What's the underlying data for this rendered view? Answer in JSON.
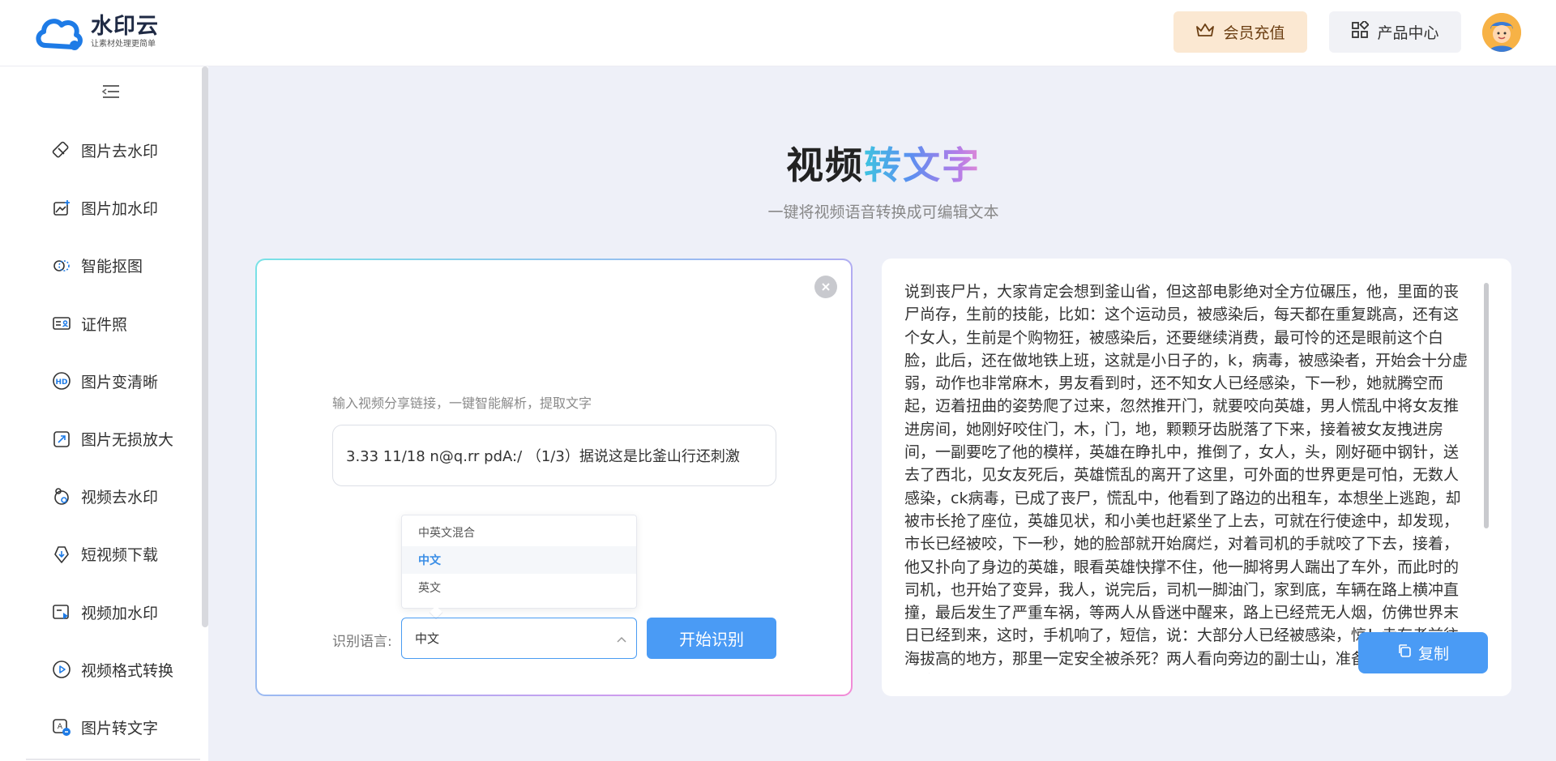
{
  "app": {
    "name": "水印云",
    "slogan": "让素材处理更简单"
  },
  "header": {
    "vip_label": "会员充值",
    "products_label": "产品中心"
  },
  "sidebar": {
    "items": [
      {
        "label": "图片去水印",
        "icon": "eraser-icon"
      },
      {
        "label": "图片加水印",
        "icon": "image-add-icon"
      },
      {
        "label": "智能抠图",
        "icon": "cutout-icon"
      },
      {
        "label": "证件照",
        "icon": "id-card-icon"
      },
      {
        "label": "图片变清晰",
        "icon": "hd-icon"
      },
      {
        "label": "图片无损放大",
        "icon": "expand-icon"
      },
      {
        "label": "视频去水印",
        "icon": "video-eraser-icon"
      },
      {
        "label": "短视频下载",
        "icon": "download-icon"
      },
      {
        "label": "视频加水印",
        "icon": "video-add-icon"
      },
      {
        "label": "视频格式转换",
        "icon": "play-circle-icon"
      },
      {
        "label": "图片转文字",
        "icon": "image-text-icon"
      }
    ]
  },
  "hero": {
    "title_part1": "视频",
    "title_part2": "转文字",
    "subtitle": "一键将视频语音转换成可编辑文本"
  },
  "input_panel": {
    "hint": "输入视频分享链接，一键智能解析，提取文字",
    "link_value": "3.33 11/18 n@q.rr pdA:/ （1/3）据说这是比釜山行还刺激",
    "language_label": "识别语言:",
    "language_selected": "中文",
    "language_options": [
      "中英文混合",
      "中文",
      "英文"
    ],
    "start_label": "开始识别"
  },
  "result_panel": {
    "text": "说到丧尸片，大家肯定会想到釜山省，但这部电影绝对全方位碾压，他，里面的丧尸尚存，生前的技能，比如：这个运动员，被感染后，每天都在重复跳高，还有这个女人，生前是个购物狂，被感染后，还要继续消费，最可怜的还是眼前这个白脸，此后，还在做地铁上班，这就是小日子的，k，病毒，被感染者，开始会十分虚弱，动作也非常麻木，男友看到时，还不知女人已经感染，下一秒，她就腾空而起，迈着扭曲的姿势爬了过来，忽然推开门，就要咬向英雄，男人慌乱中将女友推进房间，她刚好咬住门，木，门，地，颗颗牙齿脱落了下来，接着被女友拽进房间，一副要吃了他的模样，英雄在睁扎中，推倒了，女人，头，刚好砸中钢针，送去了西北，见女友死后，英雄慌乱的离开了这里，可外面的世界更是可怕，无数人感染，ck病毒，已成了丧尸，慌乱中，他看到了路边的出租车，本想坐上逃跑，却被市长抢了座位，英雄见状，和小美也赶紧坐了上去，可就在行使途中，却发现，市长已经被咬，下一秒，她的脸部就开始腐烂，对着司机的手就咬了下去，接着，他又扑向了身边的英雄，眼看英雄快撑不住，他一脚将男人踹出了车外，而此时的司机，也开始了变异，我人，说完后，司机一脚油门，家到底，车辆在路上横冲直撞，最后发生了严重车祸，等两人从昏迷中醒来，路上已经荒无人烟，仿佛世界末日已经到来，这时，手机响了，短信，说：大部分人已经被感染，惊！幸存者前往海拔高的地方，那里一定安全被杀死？两人看向旁边的副士山，准备前往躲避病毒的追击，可就在他们",
    "copy_label": "复制"
  }
}
